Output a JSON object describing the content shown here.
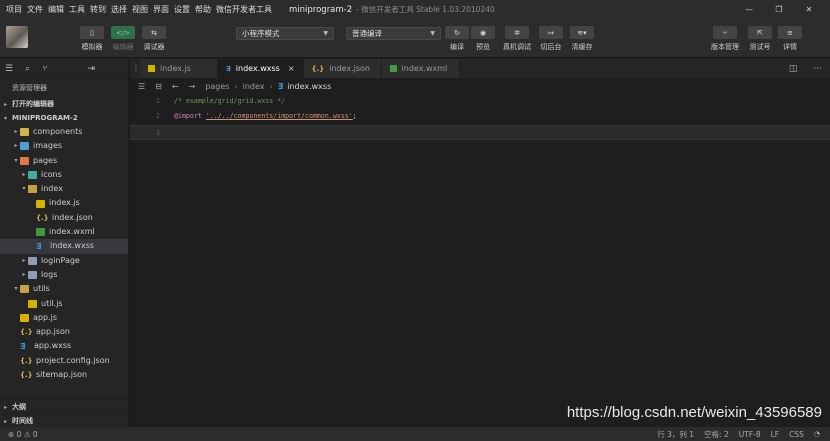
{
  "menu": [
    "项目",
    "文件",
    "编辑",
    "工具",
    "转到",
    "选择",
    "视图",
    "界面",
    "设置",
    "帮助",
    "微信开发者工具"
  ],
  "window": {
    "project": "miniprogram-2",
    "version": "- 微信开发者工具 Stable 1.03.2010240",
    "minimize": "—",
    "maximize": "❐",
    "close": "✕"
  },
  "toolbar": {
    "simulator": "模拟器",
    "editor": "编辑器",
    "debugger": "调试器",
    "mode_select": "小程序模式",
    "compile_select": "普通编译",
    "compile": "编译",
    "preview": "预览",
    "real_debug": "真机调试",
    "background": "切后台",
    "clear_cache": "清缓存",
    "version_mgmt": "版本管理",
    "test_account": "测试号",
    "details": "详情",
    "editor_btn_glyph": "</>"
  },
  "sidebar": {
    "explorer_title": "资源管理器",
    "open_editors": "打开的编辑器",
    "project_root": "MINIPROGRAM-2",
    "tree": [
      {
        "label": "components",
        "depth": 1,
        "twisty": "▸",
        "icon": "folder-components"
      },
      {
        "label": "images",
        "depth": 1,
        "twisty": "▸",
        "icon": "folder-images"
      },
      {
        "label": "pages",
        "depth": 1,
        "twisty": "▾",
        "icon": "folder-pages"
      },
      {
        "label": "icons",
        "depth": 2,
        "twisty": "▸",
        "icon": "folder-icons"
      },
      {
        "label": "index",
        "depth": 2,
        "twisty": "▾",
        "icon": "folder-open"
      },
      {
        "label": "index.js",
        "depth": 3,
        "twisty": "",
        "icon": "js"
      },
      {
        "label": "index.json",
        "depth": 3,
        "twisty": "",
        "icon": "json"
      },
      {
        "label": "index.wxml",
        "depth": 3,
        "twisty": "",
        "icon": "wxml"
      },
      {
        "label": "index.wxss",
        "depth": 3,
        "twisty": "",
        "icon": "wxss",
        "selected": true
      },
      {
        "label": "loginPage",
        "depth": 2,
        "twisty": "▸",
        "icon": "folder-plain"
      },
      {
        "label": "logs",
        "depth": 2,
        "twisty": "▸",
        "icon": "folder-plain"
      },
      {
        "label": "utils",
        "depth": 1,
        "twisty": "▾",
        "icon": "folder-open"
      },
      {
        "label": "util.js",
        "depth": 2,
        "twisty": "",
        "icon": "js"
      },
      {
        "label": "app.js",
        "depth": 1,
        "twisty": "",
        "icon": "js"
      },
      {
        "label": "app.json",
        "depth": 1,
        "twisty": "",
        "icon": "json"
      },
      {
        "label": "app.wxss",
        "depth": 1,
        "twisty": "",
        "icon": "wxss"
      },
      {
        "label": "project.config.json",
        "depth": 1,
        "twisty": "",
        "icon": "json"
      },
      {
        "label": "sitemap.json",
        "depth": 1,
        "twisty": "",
        "icon": "json"
      }
    ],
    "outline": "大纲",
    "timeline": "时间线"
  },
  "tabs": [
    {
      "label": "index.js",
      "icon": "js",
      "active": false
    },
    {
      "label": "index.wxss",
      "icon": "wxss",
      "active": true
    },
    {
      "label": "index.json",
      "icon": "json",
      "active": false
    },
    {
      "label": "index.wxml",
      "icon": "wxml",
      "active": false
    }
  ],
  "tab_close": "×",
  "breadcrumb": [
    "pages",
    "index",
    "index.wxss"
  ],
  "code": [
    {
      "ln": "1",
      "comment": "/* example/grid/grid.wxss */"
    },
    {
      "ln": "2",
      "kw": "@import",
      "str": "'../../components/import/common.wxss'",
      "punc": ";"
    },
    {
      "ln": "3"
    }
  ],
  "watermark": "https://blog.csdn.net/weixin_43596589",
  "status": {
    "problems": "⊗ 0 ⚠ 0",
    "position": "行 3，列 1",
    "indent": "空格: 2",
    "encoding": "UTF-8",
    "eol": "LF",
    "language": "CSS",
    "bell": "🔔"
  },
  "colors": {
    "accent_green": "#2f6f49",
    "wxss_blue": "#3f90d9",
    "json_yellow": "#d8b64a"
  }
}
